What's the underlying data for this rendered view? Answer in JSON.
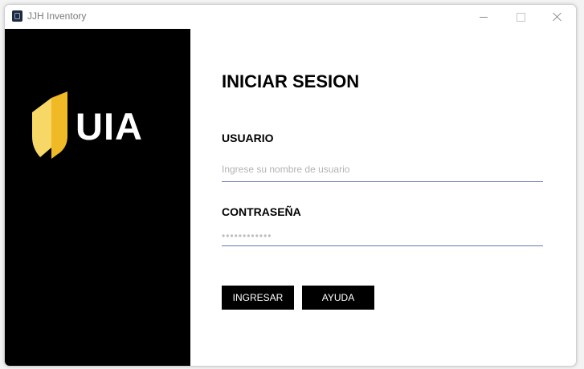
{
  "window": {
    "title": "JJH Inventory",
    "icon": "app-icon"
  },
  "branding": {
    "logo_text": "UIA",
    "logo_color": "#f5c443",
    "panel_color": "#000000"
  },
  "form": {
    "title": "INICIAR SESION",
    "username_label": "USUARIO",
    "username_placeholder": "Ingrese su nombre de usuario",
    "password_label": "CONTRASEÑA",
    "password_value": "••••••••••••",
    "accent_color": "#6a75b8"
  },
  "buttons": {
    "login_label": "INGRESAR",
    "help_label": "AYUDA"
  }
}
